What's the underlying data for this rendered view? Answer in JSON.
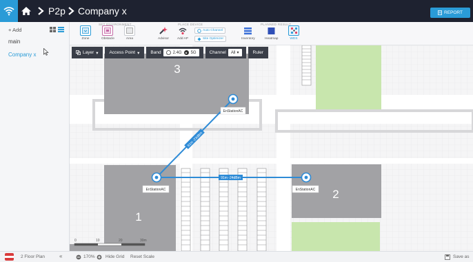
{
  "header": {
    "breadcrumb": [
      "P2p",
      "Company x"
    ],
    "report_label": "REPORT"
  },
  "sidebar": {
    "add_label": "+ Add",
    "items": [
      {
        "label": "main"
      },
      {
        "label": "Company x",
        "selected": true
      }
    ]
  },
  "toolbar": {
    "groups": [
      {
        "label": "SET ENVIRONMENT"
      },
      {
        "label": "PLACE DEVICE"
      },
      {
        "label": "PLANNED RESULT"
      }
    ],
    "tools": [
      {
        "label": "Zone"
      },
      {
        "label": "Obstacle"
      },
      {
        "label": "Area"
      },
      {
        "label": "Advisor"
      },
      {
        "label": "Add AP"
      },
      {
        "label": "Auto Channel"
      },
      {
        "label": "Site Optimizer"
      },
      {
        "label": "Inventory"
      },
      {
        "label": "Heatmap"
      },
      {
        "label": "WDS"
      }
    ]
  },
  "layerbar": {
    "layer": "Layer",
    "access_point": "Access Point",
    "band": "Band",
    "band_24": "2.4G",
    "band_5": "5G",
    "band_selected": "5G",
    "channel": "Channel",
    "channel_value": "All",
    "ruler": "Ruler"
  },
  "map": {
    "rooms": [
      "3",
      "1",
      "2"
    ],
    "access_points": [
      {
        "label": "EnStationAC"
      },
      {
        "label": "EnStationAC"
      },
      {
        "label": "EnStationAC"
      }
    ],
    "links": [
      {
        "label": "91m -23dBm"
      },
      {
        "label": "91m -24dBm"
      }
    ],
    "scale_ticks": [
      "0",
      "10",
      "20",
      "30m"
    ],
    "colors": {
      "link": "#2e8bd6",
      "room": "#9d9d9f",
      "green_zone": "#c8e6ad"
    }
  },
  "footer": {
    "floor": "2 Floor Plan",
    "zoom": "170%",
    "hide_grid": "Hide Grid",
    "reset_scale": "Reset Scale",
    "save_as": "Save as"
  }
}
